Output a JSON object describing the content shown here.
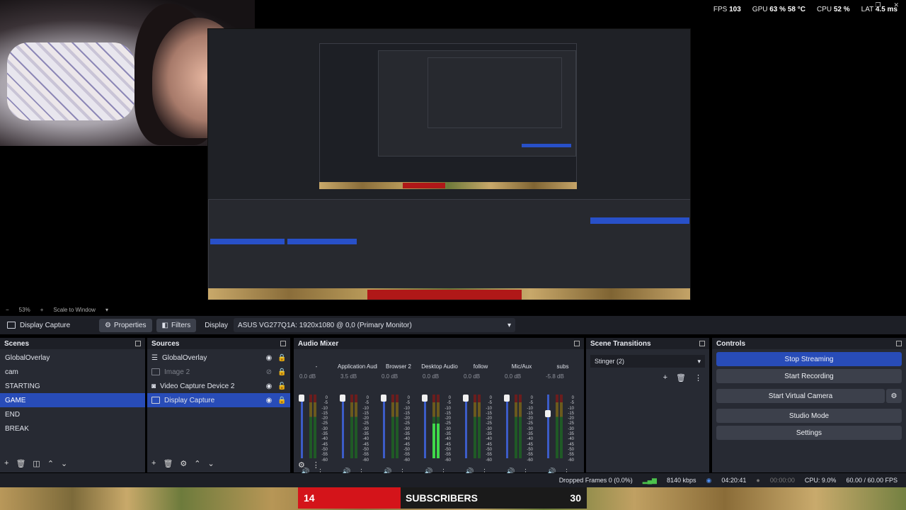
{
  "stats": {
    "fps_label": "FPS",
    "fps": "103",
    "gpu_label": "GPU",
    "gpu": "63 %",
    "gpu_temp": "58 °C",
    "cpu_label": "CPU",
    "cpu": "52 %",
    "lat_label": "LAT",
    "lat": "4.5 ms"
  },
  "preview_footer": {
    "zoom": "53%",
    "scale": "Scale to Window"
  },
  "context": {
    "source": "Display Capture",
    "properties": "Properties",
    "filters": "Filters",
    "display_label": "Display",
    "display_value": "ASUS VG277Q1A: 1920x1080 @ 0,0 (Primary Monitor)"
  },
  "scenes": {
    "title": "Scenes",
    "items": [
      "GlobalOverlay",
      "cam",
      "STARTING",
      "GAME",
      "END",
      "BREAK"
    ],
    "selected": "GAME"
  },
  "sources": {
    "title": "Sources",
    "items": [
      {
        "name": "GlobalOverlay"
      },
      {
        "name": "Image 2"
      },
      {
        "name": "Video Capture Device 2"
      },
      {
        "name": "Display Capture"
      }
    ]
  },
  "mixer": {
    "title": "Audio Mixer",
    "channels": [
      {
        "name": "-",
        "db": "0.0 dB",
        "level": 0.0
      },
      {
        "name": "Application Audio C",
        "db": "3.5 dB",
        "level": 0.0
      },
      {
        "name": "Browser 2",
        "db": "0.0 dB",
        "level": 0.0
      },
      {
        "name": "Desktop Audio",
        "db": "0.0 dB",
        "level": 0.55
      },
      {
        "name": "follow",
        "db": "0.0 dB",
        "level": 0.0
      },
      {
        "name": "Mic/Aux",
        "db": "0.0 dB",
        "level": 0.0
      },
      {
        "name": "subs",
        "db": "-5.8 dB",
        "level": 0.0
      }
    ],
    "scale": [
      "0",
      "-5",
      "-10",
      "-15",
      "-20",
      "-25",
      "-30",
      "-35",
      "-40",
      "-45",
      "-50",
      "-55",
      "-60"
    ]
  },
  "transitions": {
    "title": "Scene Transitions",
    "selected": "Stinger (2)"
  },
  "controls": {
    "title": "Controls",
    "stop_streaming": "Stop Streaming",
    "start_recording": "Start Recording",
    "start_virtual_camera": "Start Virtual Camera",
    "studio_mode": "Studio Mode",
    "settings": "Settings"
  },
  "status": {
    "dropped": "Dropped Frames 0 (0.0%)",
    "bitrate": "8140 kbps",
    "stream_time": "04:20:41",
    "rec_time": "00:00:00",
    "cpu": "CPU: 9.0%",
    "fps": "60.00 / 60.00 FPS"
  },
  "banner": {
    "left": "14",
    "label": "SUBSCRIBERS",
    "right": "30"
  },
  "colors": {
    "accent": "#284cb8",
    "banner_red": "#d4141a",
    "panel": "#272a33",
    "title_bar": "#1d1f26"
  }
}
